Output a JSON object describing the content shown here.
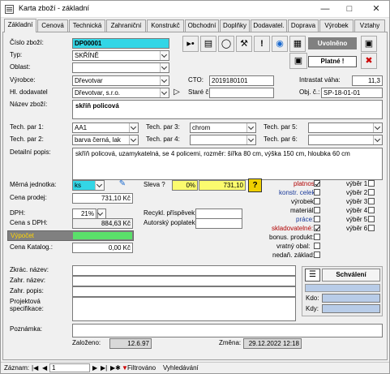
{
  "window": {
    "title": "Karta zboží - základní"
  },
  "tabs": [
    "Základní",
    "Cenová",
    "Technická",
    "Zahraniční",
    "Konstrukč",
    "Obchodní",
    "Doplňky",
    "Dodavatel.",
    "Doprava",
    "Výrobek",
    "Vztahy"
  ],
  "header": {
    "cislo_label": "Číslo zboží:",
    "cislo_value": "DP00001",
    "typ_label": "Typ:",
    "typ_value": "SKŘÍNĚ",
    "oblast_label": "Oblast:",
    "oblast_value": "",
    "vyrobce_label": "Výrobce:",
    "vyrobce_value": "Dřevotvar",
    "hl_dodavatel_label": "Hl. dodavatel",
    "hl_dodavatel_value": "Dřevotvar, s.r.o.",
    "cto_label": "CTO:",
    "cto_value": "2019180101",
    "stare_label": "Staré č.:",
    "stare_value": "",
    "intrastat_label": "Intrastat váha:",
    "intrastat_value": "11,3",
    "obj_label": "Obj. č.:",
    "obj_value": "SP-18-01-01",
    "status_label": "Uvolněno",
    "platne_label": "Platné !",
    "nazev_label": "Název zboží:",
    "nazev_value": "skříň policová"
  },
  "tech": {
    "p1_label": "Tech. par 1:",
    "p1_value": "AA1",
    "p2_label": "Tech. par 2:",
    "p2_value": "barva černá, lak",
    "p3_label": "Tech. par 3:",
    "p3_value": "chrom",
    "p4_label": "Tech. par 4:",
    "p4_value": "",
    "p5_label": "Tech. par 5:",
    "p5_value": "",
    "p6_label": "Tech. par 6:",
    "p6_value": ""
  },
  "popis": {
    "label": "Detailní popis:",
    "value": "skříň policová, uzamykatelná, se 4 policemi, rozměr: šířka 80 cm, výška 150 cm, hloubka 60 cm"
  },
  "price": {
    "mj_label": "Měrná jednotka:",
    "mj_value": "ks",
    "cena_prodej_label": "Cena prodej:",
    "cena_prodej_value": "731,10 Kč",
    "sleva_label": "Sleva ?",
    "sleva_pct": "0%",
    "sleva_value": "731,10",
    "dph_label": "DPH:",
    "dph_value": "21%",
    "cena_s_dph_label": "Cena s DPH:",
    "cena_s_dph_value": "884,63 Kč",
    "vypocet_label": "Výpočet",
    "cena_katalog_label": "Cena Katalog.:",
    "cena_katalog_value": "0,00 Kč",
    "recykl_label": "Recykl. příspěvek:",
    "recykl_value": "",
    "autorsky_label": "Autorský poplatek:",
    "autorsky_value": ""
  },
  "flags": [
    {
      "label": "platnost:",
      "checked": true,
      "color": "#b00000"
    },
    {
      "label": "konstr. celek:",
      "checked": false,
      "color": "#1a3a9a"
    },
    {
      "label": "výrobek:",
      "checked": false,
      "color": "#000000"
    },
    {
      "label": "materiál:",
      "checked": false,
      "color": "#000000"
    },
    {
      "label": "práce:",
      "checked": false,
      "color": "#1a3a9a"
    },
    {
      "label": "skladovatelné:",
      "checked": true,
      "color": "#b00000"
    },
    {
      "label": "bonus. produkt:",
      "checked": false,
      "color": "#000000"
    },
    {
      "label": "vratný obal:",
      "checked": false,
      "color": "#000000"
    },
    {
      "label": "nedaň. základ:",
      "checked": false,
      "color": "#000000"
    }
  ],
  "vyber": [
    "výběr 1:",
    "výběr 2:",
    "výběr 3:",
    "výběr 4:",
    "výběr 5:",
    "výběr 6:"
  ],
  "bottom": {
    "zkrac_label": "Zkrác. název:",
    "zahr_nazev_label": "Zahr. název:",
    "zahr_popis_label": "Zahr. popis:",
    "projektova_label": "Projektová",
    "specifikace_label": "specifikace:",
    "poznamka_label": "Poznámka:",
    "zalozeno_label": "Založeno:",
    "zalozeno_value": "12.6.97",
    "zmena_label": "Změna:",
    "zmena_value": "29.12.2022 12:18"
  },
  "schvaleni": {
    "button": "Schválení",
    "kdo_label": "Kdo:",
    "kdy_label": "Kdy:"
  },
  "navbar": {
    "zaznam_label": "Záznam:",
    "record": "1",
    "filter_label": "Filtrováno",
    "search_label": "Vyhledávání"
  },
  "colors": {
    "cyan": "#33d6e6",
    "yellow": "#fbfb6e",
    "green": "#5ae06a",
    "gray_dark": "#808080",
    "light_blue": "#b8cce8"
  }
}
